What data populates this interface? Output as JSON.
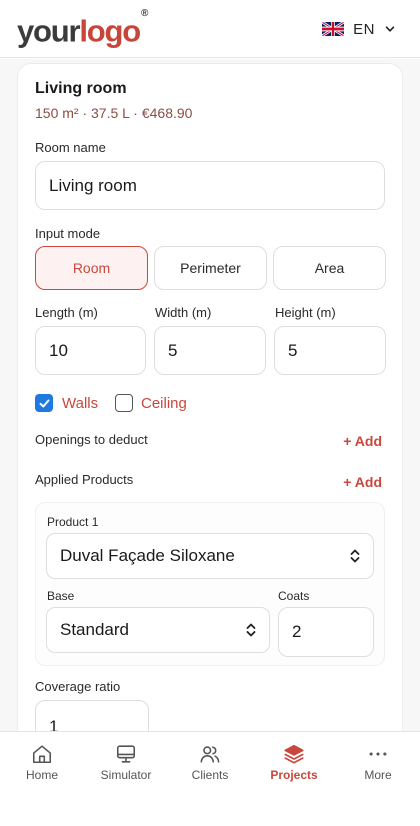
{
  "brand": {
    "logo_part1": "your",
    "logo_part2": "logo",
    "logo_mark": "®",
    "accent": "#c9473c"
  },
  "language": {
    "code": "EN",
    "flag_icon": "uk-flag-icon"
  },
  "room": {
    "title": "Living room",
    "meta": "150 m² · 37.5 L · €468.90",
    "name_label": "Room name",
    "name_value": "Living room",
    "input_mode_label": "Input mode",
    "modes": [
      "Room",
      "Perimeter",
      "Area"
    ],
    "active_mode": "Room",
    "length_label": "Length (m)",
    "width_label": "Width (m)",
    "height_label": "Height (m)",
    "length": "10",
    "width": "5",
    "height": "5",
    "walls_label": "Walls",
    "walls_checked": true,
    "ceiling_label": "Ceiling",
    "ceiling_checked": false,
    "openings_label": "Openings to deduct",
    "openings_add": "+ Add",
    "products_label": "Applied Products",
    "products_add": "+ Add",
    "product": {
      "label": "Product 1",
      "name": "Duval Façade Siloxane",
      "base_label": "Base",
      "base": "Standard",
      "coats_label": "Coats",
      "coats": "2"
    },
    "coverage_label": "Coverage ratio",
    "coverage_value": "1"
  },
  "tabs": [
    {
      "label": "Home",
      "icon": "home-icon"
    },
    {
      "label": "Simulator",
      "icon": "monitor-icon"
    },
    {
      "label": "Clients",
      "icon": "users-icon"
    },
    {
      "label": "Projects",
      "icon": "layers-icon"
    },
    {
      "label": "More",
      "icon": "more-icon"
    }
  ],
  "active_tab": "Projects"
}
